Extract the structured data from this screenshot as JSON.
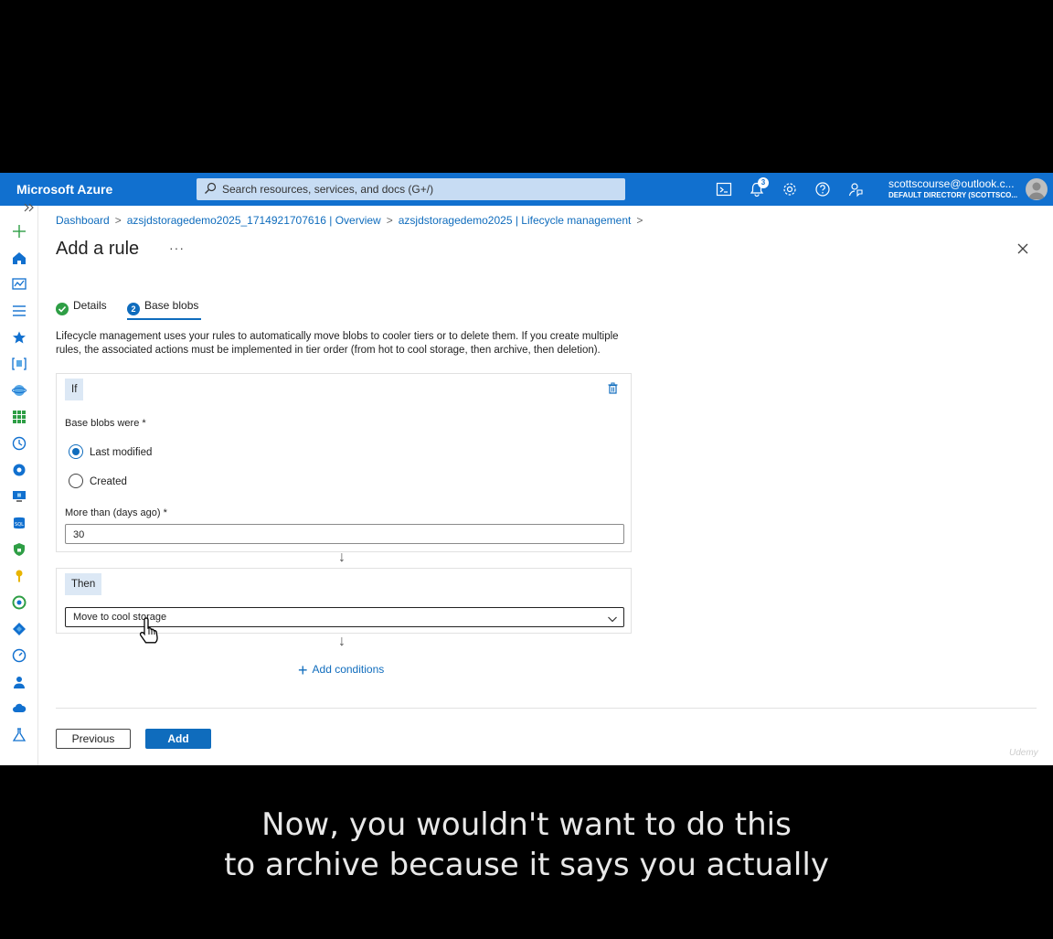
{
  "topbar": {
    "brand": "Microsoft Azure",
    "search_placeholder": "Search resources, services, and docs (G+/)",
    "notification_count": "3",
    "account_email": "scottscourse@outlook.c...",
    "account_directory": "DEFAULT DIRECTORY (SCOTTSCO..."
  },
  "breadcrumb": [
    "Dashboard",
    "azsjdstoragedemo2025_1714921707616 | Overview",
    "azsjdstoragedemo2025 | Lifecycle management"
  ],
  "page": {
    "title": "Add a rule",
    "more_label": "···"
  },
  "tabs": [
    {
      "label": "Details",
      "state": "completed"
    },
    {
      "label": "Base blobs",
      "number": "2",
      "state": "active"
    }
  ],
  "description": "Lifecycle management uses your rules to automatically move blobs to cooler tiers or to delete them. If you create multiple rules, the associated actions must be implemented in tier order (from hot to cool storage, then archive, then deletion).",
  "if_block": {
    "chip": "If",
    "base_blobs_label": "Base blobs were *",
    "options": [
      {
        "label": "Last modified",
        "selected": true
      },
      {
        "label": "Created",
        "selected": false
      }
    ],
    "days_label": "More than (days ago) *",
    "days_value": "30"
  },
  "then_block": {
    "chip": "Then",
    "action_value": "Move to cool storage"
  },
  "add_conditions_label": "Add conditions",
  "buttons": {
    "previous": "Previous",
    "add": "Add"
  },
  "watermark": "Udemy",
  "caption": {
    "line1": "Now, you wouldn't want to do this",
    "line2": "to archive because it says you actually"
  },
  "colors": {
    "topbar": "#1170cf",
    "accent": "#0f6cbd",
    "success": "#2e9e45"
  }
}
